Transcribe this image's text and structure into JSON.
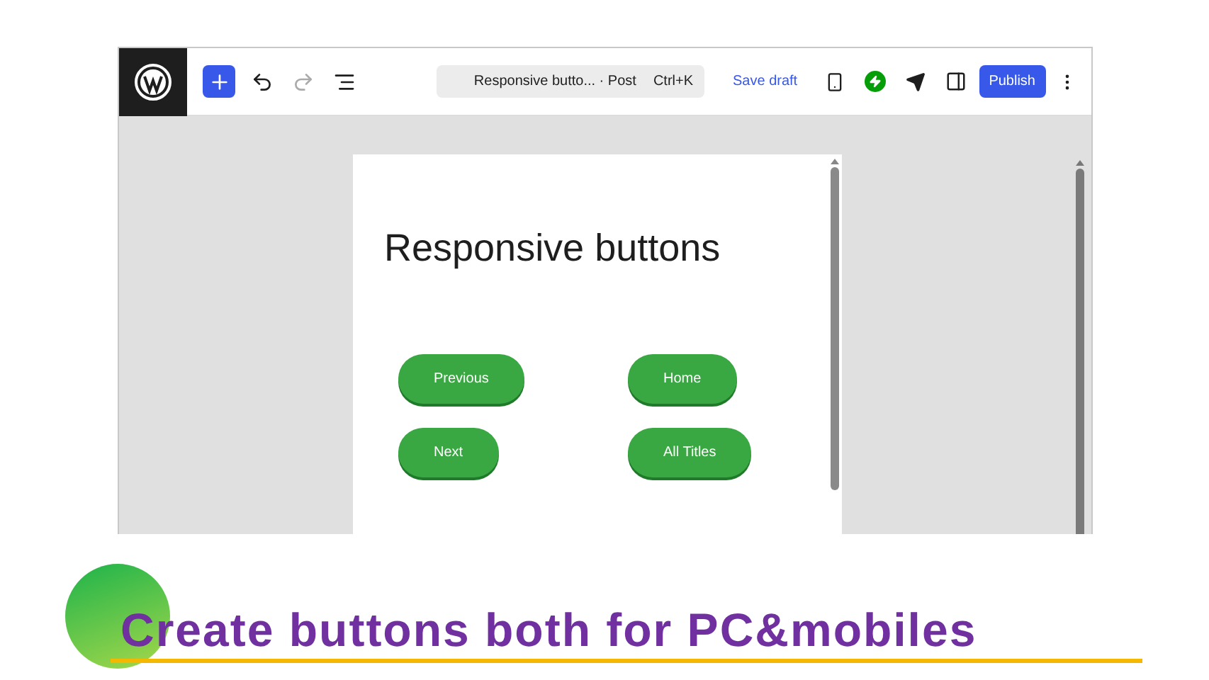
{
  "toolbar": {
    "document_title": "Responsive butto... · Post",
    "shortcut": "Ctrl+K",
    "save_draft": "Save draft",
    "publish": "Publish",
    "redo_disabled": true
  },
  "page": {
    "heading": "Responsive buttons",
    "buttons": [
      {
        "label": "Previous"
      },
      {
        "label": "Home"
      },
      {
        "label": "Next"
      },
      {
        "label": "All Titles"
      }
    ]
  },
  "caption": "Create buttons both for PC&mobiles"
}
